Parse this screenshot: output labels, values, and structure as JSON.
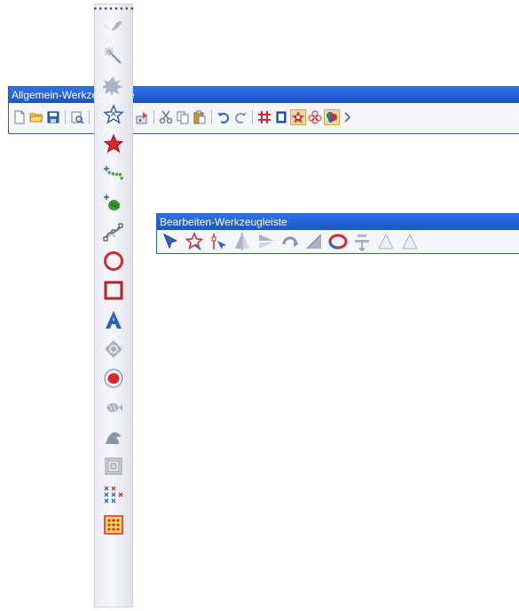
{
  "general_toolbar": {
    "title": "Allgemein-Werkzeugleiste",
    "tools": [
      {
        "icon": "new-document-icon"
      },
      {
        "icon": "open-folder-icon"
      },
      {
        "icon": "save-disk-icon"
      },
      {
        "sep": true
      },
      {
        "icon": "print-preview-icon"
      },
      {
        "sep": true
      },
      {
        "icon": "screen-icon"
      },
      {
        "sep": true
      },
      {
        "icon": "import-icon"
      },
      {
        "icon": "export-icon"
      },
      {
        "sep": true
      },
      {
        "icon": "cut-scissors-icon"
      },
      {
        "icon": "copy-icon"
      },
      {
        "icon": "paste-icon"
      },
      {
        "sep": true
      },
      {
        "icon": "undo-icon"
      },
      {
        "icon": "redo-icon"
      },
      {
        "sep": true
      },
      {
        "icon": "grid-hash-icon"
      },
      {
        "icon": "page-icon"
      },
      {
        "icon": "stitch-star-icon",
        "active": true
      },
      {
        "icon": "flower-outline-icon"
      },
      {
        "icon": "color-palette-icon",
        "active": true
      },
      {
        "icon": "more-icon"
      }
    ]
  },
  "edit_toolbar": {
    "title": "Bearbeiten-Werkzeugleiste",
    "tools": [
      {
        "icon": "select-arrow-icon"
      },
      {
        "icon": "select-star-icon"
      },
      {
        "icon": "node-select-icon"
      },
      {
        "icon": "mirror-vertical-icon"
      },
      {
        "icon": "mirror-horizontal-icon"
      },
      {
        "icon": "rotate-icon"
      },
      {
        "icon": "skew-icon"
      },
      {
        "icon": "transform-ring-icon"
      },
      {
        "icon": "align-center-icon"
      },
      {
        "icon": "triangle-outline-icon"
      },
      {
        "icon": "triangle-outline-icon-2"
      }
    ]
  },
  "vertical_toolbar": {
    "grip": "••••••••",
    "tools": [
      {
        "icon": "wave-icon"
      },
      {
        "icon": "magic-wand-icon"
      },
      {
        "icon": "burst-icon"
      },
      {
        "icon": "star-outline-icon"
      },
      {
        "icon": "star-filled-icon"
      },
      {
        "icon": "running-stitch-icon"
      },
      {
        "icon": "fill-stitch-icon"
      },
      {
        "icon": "bezier-curve-icon"
      },
      {
        "icon": "circle-icon"
      },
      {
        "icon": "square-icon"
      },
      {
        "icon": "lettering-a-icon"
      },
      {
        "icon": "monogram-icon"
      },
      {
        "icon": "applique-icon"
      },
      {
        "icon": "fish-motif-icon"
      },
      {
        "icon": "hand-icon"
      },
      {
        "icon": "frame-icon"
      },
      {
        "icon": "cross-stitch-icon"
      },
      {
        "icon": "dotted-square-icon"
      }
    ]
  },
  "colors": {
    "titlebar": "#1f5fd1",
    "accent_red": "#d9272e",
    "accent_blue": "#2b62c8",
    "active_bg": "#f8d79a"
  }
}
